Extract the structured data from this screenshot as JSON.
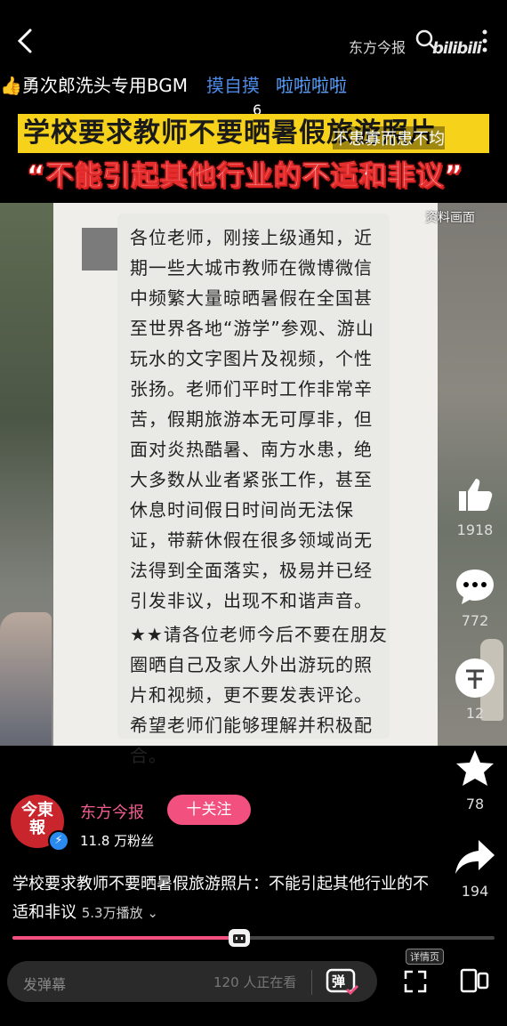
{
  "header": {
    "watermark_channel": "东方今报",
    "site_logo": "bilibili"
  },
  "danmaku": {
    "line1_prefix": "👍",
    "line1": "勇次郎洗头专用BGM",
    "line2": "摸自摸",
    "line3": "啦啦啦啦",
    "line4": "6",
    "line5": "不患寡而患不均"
  },
  "headline": {
    "yellow": "学校要求教师不要晒暑假旅游照片",
    "red": "“不能引起其他行业的不适和非议”"
  },
  "video": {
    "source_label": "资料画面",
    "notice_text": "各位老师，刚接上级通知，近期一些大城市教师在微博微信中频繁大量晾晒暑假在全国甚至世界各地“游学”参观、游山玩水的文字图片及视频，个性张扬。老师们平时工作非常辛苦，假期旅游本无可厚非，但面对炎热酷暑、南方水患，绝大多数从业者紧张工作，甚至休息时间假日时间尚无法保证，带薪休假在很多领域尚无法得到全面落实，极易并已经引发非议，出现不和谐声音。",
    "notice_text2": "★★请各位老师今后不要在朋友圈晒自己及家人外出游玩的照片和视频，更不要发表评论。希望老师们能够理解并积极配合。"
  },
  "actions": {
    "like_count": "1918",
    "comment_count": "772",
    "coin_count": "12",
    "fav_count": "78",
    "share_count": "194"
  },
  "uploader": {
    "name": "东方今报",
    "follow_label": "十关注",
    "fans": "11.8 万粉丝",
    "avatar_text": "今東報"
  },
  "video_info": {
    "title": "学校要求教师不要晒暑假旅游照片：不能引起其他行业的不适和非议",
    "plays": "5.3万播放",
    "progress": 0.47
  },
  "bottom_bar": {
    "danmaku_placeholder": "发弹幕",
    "watching": "120 人正在看",
    "danmaku_button": "弹",
    "detail_label": "详情页"
  }
}
